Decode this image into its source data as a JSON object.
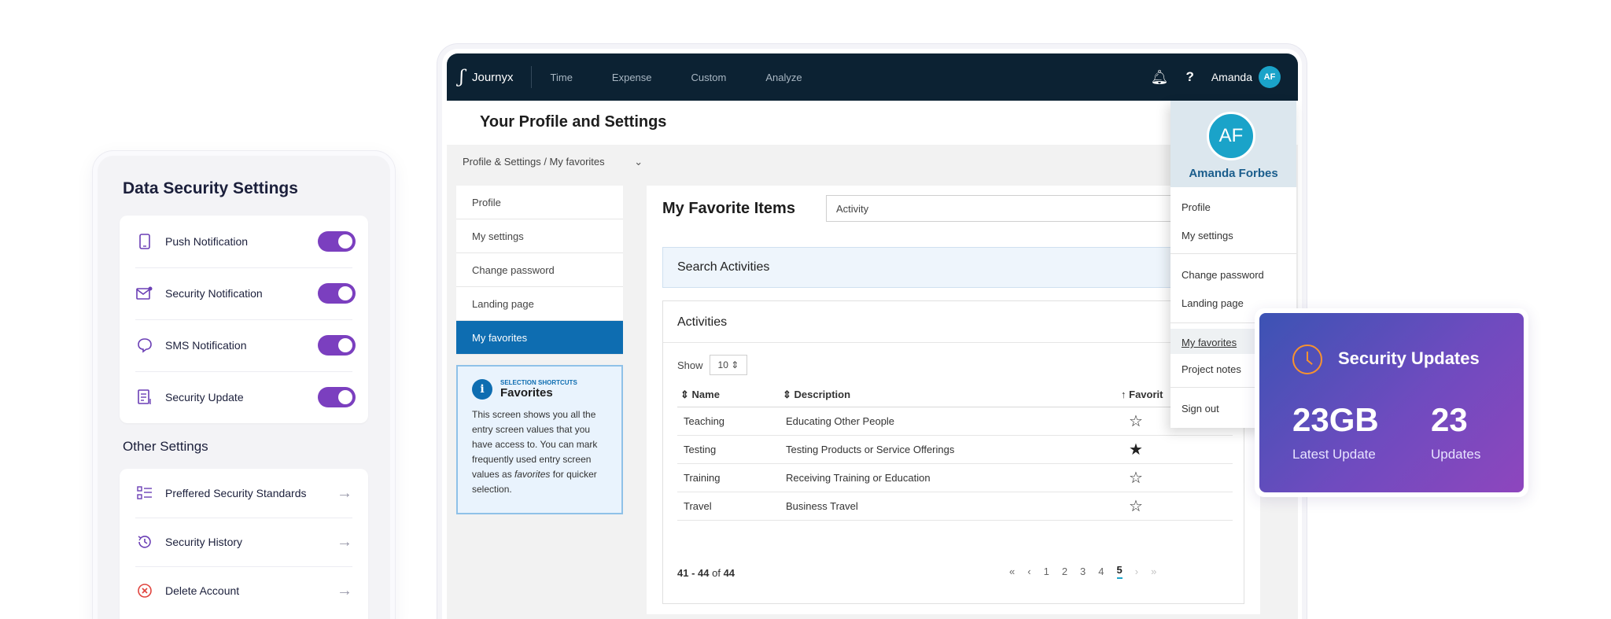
{
  "security_panel": {
    "title": "Data Security Settings",
    "toggles": [
      {
        "label": "Push Notification",
        "icon": "phone-icon",
        "on": true
      },
      {
        "label": "Security Notification",
        "icon": "mail-alert-icon",
        "on": true
      },
      {
        "label": "SMS Notification",
        "icon": "chat-bubble-icon",
        "on": true
      },
      {
        "label": "Security Update",
        "icon": "document-icon",
        "on": true
      }
    ],
    "other_title": "Other Settings",
    "other": [
      {
        "label": "Preffered Security Standards",
        "icon": "list-icon"
      },
      {
        "label": "Security History",
        "icon": "history-icon"
      },
      {
        "label": "Delete Account",
        "icon": "delete-circle-icon"
      }
    ],
    "accent": "#7b3fbf"
  },
  "app": {
    "brand": "Journyx",
    "nav": [
      "Time",
      "Expense",
      "Custom",
      "Analyze"
    ],
    "user_name": "Amanda",
    "user_initials": "AF",
    "page_title": "Your Profile and Settings",
    "breadcrumb": "Profile & Settings  /  My favorites",
    "sidenav": [
      "Profile",
      "My settings",
      "Change password",
      "Landing page",
      "My favorites"
    ],
    "sidenav_active": "My favorites",
    "hint": {
      "eyebrow": "SELECTION SHORTCUTS",
      "title": "Favorites",
      "body_1": "This screen shows you all the entry screen values that you have access to. You can mark frequently used entry screen values as",
      "body_em": "favorites",
      "body_2": "for quicker selection."
    },
    "favorites": {
      "title": "My Favorite Items",
      "select_value": "Activity",
      "search_label": "Search Activities",
      "section_label": "Activities",
      "show_label": "Show",
      "show_value": "10",
      "columns": [
        "Name",
        "Description",
        "Favorit"
      ],
      "rows": [
        {
          "name": "Teaching",
          "description": "Educating Other People",
          "favorite": false
        },
        {
          "name": "Testing",
          "description": "Testing Products or Service Offerings",
          "favorite": true
        },
        {
          "name": "Training",
          "description": "Receiving Training or Education",
          "favorite": false
        },
        {
          "name": "Travel",
          "description": "Business Travel",
          "favorite": false
        }
      ],
      "range_text": "41 - 44",
      "range_of": "of",
      "range_total": "44",
      "pages": [
        "1",
        "2",
        "3",
        "4",
        "5"
      ],
      "current_page": "5"
    },
    "dropdown": {
      "initials": "AF",
      "full_name": "Amanda Forbes",
      "items": [
        "Profile",
        "My settings",
        "Change password",
        "Landing page",
        "My favorites",
        "Project notes",
        "Sign out"
      ]
    }
  },
  "updates_card": {
    "title": "Security Updates",
    "stat1_value": "23GB",
    "stat1_label": "Latest Update",
    "stat2_value": "23",
    "stat2_label": "Updates"
  }
}
